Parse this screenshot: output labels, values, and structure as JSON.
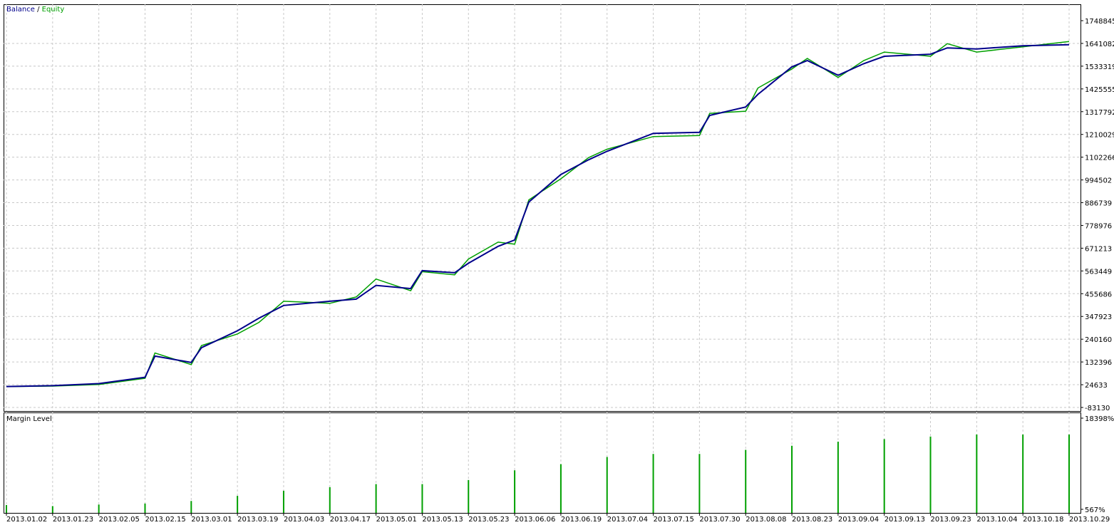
{
  "legend": {
    "balance_label": "Balance",
    "separator": "/",
    "equity_label": "Equity",
    "balance_color": "#00008b",
    "equity_color": "#00a000"
  },
  "margin_panel": {
    "title": "Margin Level",
    "bar_color": "#00a000"
  },
  "chart_data": [
    {
      "type": "line",
      "title": "",
      "legend_placement": "top-left",
      "grid": true,
      "ylim": [
        -83130,
        1748845
      ],
      "y_ticks": [
        "1748845",
        "1641082",
        "1533319",
        "1425555",
        "1317792",
        "1210029",
        "1102266",
        "994502",
        "886739",
        "778976",
        "671213",
        "563449",
        "455686",
        "347923",
        "240160",
        "132396",
        "24633",
        "-83130"
      ],
      "x_ticks": [
        "2013.01.02",
        "2013.01.23",
        "2013.02.05",
        "2013.02.15",
        "2013.03.01",
        "2013.03.19",
        "2013.04.03",
        "2013.04.17",
        "2013.05.01",
        "2013.05.13",
        "2013.05.23",
        "2013.06.06",
        "2013.06.19",
        "2013.07.04",
        "2013.07.15",
        "2013.07.30",
        "2013.08.08",
        "2013.08.23",
        "2013.09.04",
        "2013.09.13",
        "2013.09.23",
        "2013.10.04",
        "2013.10.18",
        "2013.10.29"
      ],
      "series": [
        {
          "name": "Balance",
          "x": [
            "2013.01.02",
            "2013.01.23",
            "2013.02.05",
            "2013.02.15",
            "2013.02.18",
            "2013.03.01",
            "2013.03.05",
            "2013.03.19",
            "2013.03.26",
            "2013.04.03",
            "2013.04.17",
            "2013.04.25",
            "2013.05.01",
            "2013.05.10",
            "2013.05.13",
            "2013.05.20",
            "2013.05.23",
            "2013.06.01",
            "2013.06.06",
            "2013.06.10",
            "2013.06.19",
            "2013.06.28",
            "2013.07.04",
            "2013.07.15",
            "2013.07.30",
            "2013.08.01",
            "2013.08.08",
            "2013.08.12",
            "2013.08.23",
            "2013.08.27",
            "2013.09.04",
            "2013.09.09",
            "2013.09.13",
            "2013.09.23",
            "2013.09.27",
            "2013.10.04",
            "2013.10.18",
            "2013.10.29"
          ],
          "values": [
            16000,
            20000,
            30000,
            60000,
            160000,
            130000,
            200000,
            280000,
            340000,
            400000,
            420000,
            430000,
            495000,
            480000,
            565000,
            555000,
            600000,
            680000,
            710000,
            890000,
            1020000,
            1090000,
            1130000,
            1215000,
            1220000,
            1300000,
            1340000,
            1400000,
            1530000,
            1560000,
            1490000,
            1545000,
            1580000,
            1590000,
            1620000,
            1615000,
            1630000,
            1635000
          ]
        },
        {
          "name": "Equity",
          "x": [
            "2013.01.02",
            "2013.01.23",
            "2013.02.05",
            "2013.02.15",
            "2013.02.18",
            "2013.03.01",
            "2013.03.05",
            "2013.03.19",
            "2013.03.26",
            "2013.04.03",
            "2013.04.17",
            "2013.04.25",
            "2013.05.01",
            "2013.05.10",
            "2013.05.13",
            "2013.05.20",
            "2013.05.23",
            "2013.06.01",
            "2013.06.06",
            "2013.06.10",
            "2013.06.19",
            "2013.06.28",
            "2013.07.04",
            "2013.07.15",
            "2013.07.30",
            "2013.08.01",
            "2013.08.08",
            "2013.08.12",
            "2013.08.23",
            "2013.08.27",
            "2013.09.04",
            "2013.09.09",
            "2013.09.13",
            "2013.09.23",
            "2013.09.27",
            "2013.10.04",
            "2013.10.18",
            "2013.10.29"
          ],
          "values": [
            16000,
            18000,
            26000,
            55000,
            175000,
            120000,
            210000,
            265000,
            320000,
            420000,
            410000,
            440000,
            525000,
            470000,
            560000,
            545000,
            620000,
            700000,
            690000,
            900000,
            1000000,
            1100000,
            1140000,
            1200000,
            1205000,
            1310000,
            1320000,
            1430000,
            1520000,
            1570000,
            1480000,
            1560000,
            1600000,
            1580000,
            1640000,
            1600000,
            1625000,
            1650000
          ]
        }
      ]
    },
    {
      "type": "bar",
      "title": "Margin Level",
      "y_ticks": [
        "18398%",
        "567%"
      ],
      "ylim": [
        567,
        18398
      ],
      "x_ticks": [
        "2013.01.02",
        "2013.01.23",
        "2013.02.05",
        "2013.02.15",
        "2013.03.01",
        "2013.03.19",
        "2013.04.03",
        "2013.04.17",
        "2013.05.01",
        "2013.05.13",
        "2013.05.23",
        "2013.06.06",
        "2013.06.19",
        "2013.07.04",
        "2013.07.15",
        "2013.07.30",
        "2013.08.08",
        "2013.08.23",
        "2013.09.04",
        "2013.09.13",
        "2013.09.23",
        "2013.10.04",
        "2013.10.18",
        "2013.10.29"
      ],
      "series": [
        {
          "name": "Margin Level",
          "x": [
            "2013.01.02",
            "2013.01.23",
            "2013.02.05",
            "2013.02.15",
            "2013.03.01",
            "2013.03.19",
            "2013.04.03",
            "2013.04.17",
            "2013.05.01",
            "2013.05.13",
            "2013.05.23",
            "2013.06.06",
            "2013.06.19",
            "2013.07.04",
            "2013.07.15",
            "2013.07.30",
            "2013.08.08",
            "2013.08.23",
            "2013.09.04",
            "2013.09.13",
            "2013.09.23",
            "2013.10.04",
            "2013.10.18",
            "2013.10.29"
          ],
          "values": [
            1400,
            1200,
            1500,
            1700,
            2200,
            3200,
            4200,
            4900,
            5500,
            5500,
            6300,
            8200,
            9400,
            10800,
            11400,
            11400,
            12200,
            13000,
            13800,
            14300,
            14800,
            15200,
            15200,
            15200
          ]
        }
      ]
    }
  ]
}
